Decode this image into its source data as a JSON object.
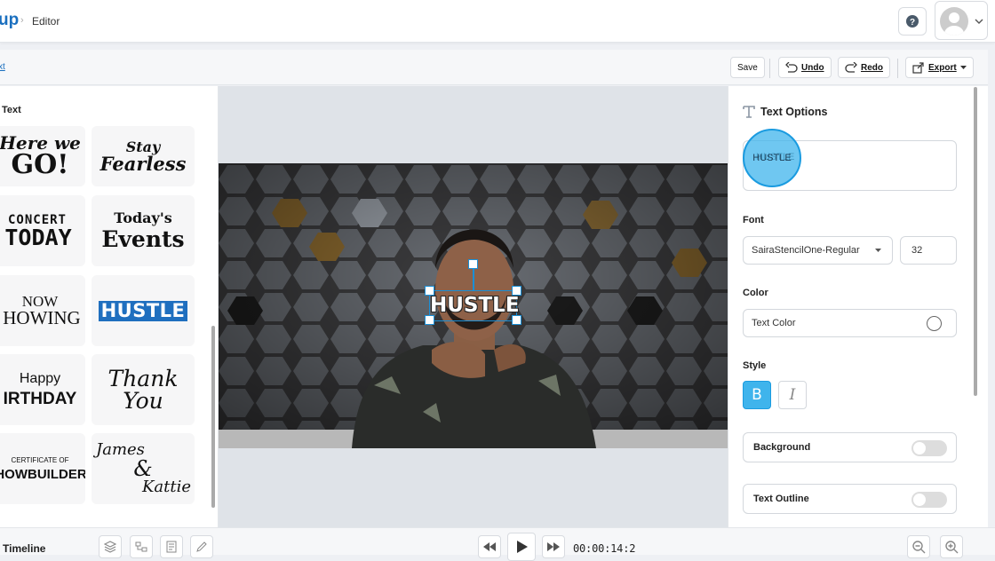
{
  "header": {
    "logo_partial": "up",
    "crumb_sep": "›",
    "crumb": "Editor"
  },
  "toolbar": {
    "tab_partial": "xt",
    "save": "Save",
    "undo": "Undo",
    "redo": "Redo",
    "export": "Export"
  },
  "left_panel": {
    "title": "Text",
    "tiles": [
      {
        "lines": [
          "Here we",
          "GO!"
        ]
      },
      {
        "lines": [
          "Stay",
          "Fearless"
        ]
      },
      {
        "lines": [
          "CONCERT",
          "TODAY"
        ]
      },
      {
        "lines": [
          "Today's",
          "Events"
        ]
      },
      {
        "lines": [
          "NOW",
          "HOWING"
        ]
      },
      {
        "lines": [
          "HUSTLE"
        ]
      },
      {
        "lines": [
          "Happy",
          "IRTHDAY"
        ]
      },
      {
        "lines": [
          "Thank",
          "You"
        ]
      },
      {
        "lines": [
          "CERTIFICATE OF",
          "HOWBUILDER"
        ]
      },
      {
        "lines": [
          "James",
          "&",
          "Kattie"
        ]
      }
    ]
  },
  "canvas": {
    "overlay_text": "HUSTLE"
  },
  "right_panel": {
    "title": "Text Options",
    "text_value": "HUSTLE",
    "font_label": "Font",
    "font_value": "SairaStencilOne-Regular",
    "font_size": "32",
    "color_label": "Color",
    "color_value": "Text Color",
    "style_label": "Style",
    "bold": "B",
    "italic": "I",
    "background_label": "Background",
    "outline_label": "Text Outline"
  },
  "bottom": {
    "timeline": "Timeline",
    "time": "00:00:14:2"
  },
  "colors": {
    "accent": "#1a9be0",
    "brand": "#1a6fbf",
    "highlight": "#3fb4ec"
  }
}
